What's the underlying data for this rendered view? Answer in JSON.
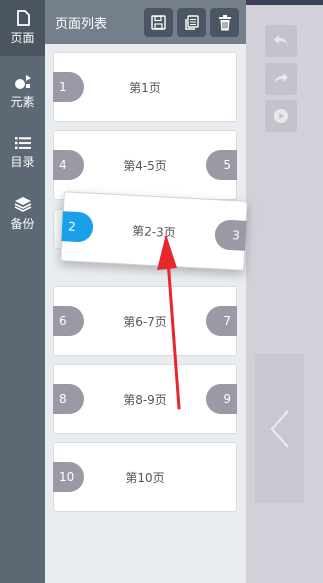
{
  "nav": {
    "items": [
      {
        "label": "页面",
        "icon": "page-icon"
      },
      {
        "label": "元素",
        "icon": "elements-icon"
      },
      {
        "label": "目录",
        "icon": "list-icon"
      },
      {
        "label": "备份",
        "icon": "layers-icon"
      }
    ]
  },
  "panel": {
    "title": "页面列表",
    "header_buttons": [
      "save-icon",
      "copy-icon",
      "delete-icon"
    ]
  },
  "pages": [
    {
      "label": "第1页",
      "left": "1",
      "right": ""
    },
    {
      "label": "第4-5页",
      "left": "4",
      "right": "5"
    },
    {
      "label": "第6-7页",
      "left": "6",
      "right": "7"
    },
    {
      "label": "第8-9页",
      "left": "8",
      "right": "9"
    },
    {
      "label": "第10页",
      "left": "10",
      "right": ""
    }
  ],
  "dragging": {
    "label": "第2-3页",
    "left": "2",
    "right": "3"
  },
  "tools": [
    "undo-icon",
    "redo-icon",
    "play-icon"
  ],
  "colors": {
    "accent": "#1aa0e8",
    "tab": "#9c98a6",
    "nav": "#5c6874",
    "arrow": "#e8262d"
  }
}
